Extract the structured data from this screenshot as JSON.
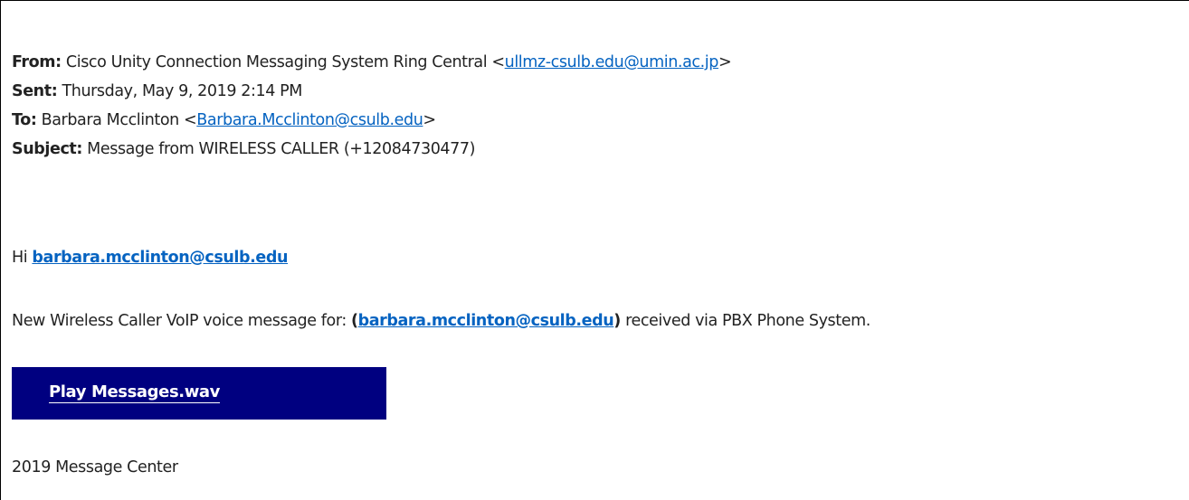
{
  "colors": {
    "link": "#0563c1",
    "button_bg": "#000080",
    "button_text": "#ffffff",
    "text": "#222222"
  },
  "header": {
    "from_label": "From:",
    "from_name": "Cisco Unity Connection Messaging System Ring Central <",
    "from_email": "ullmz-csulb.edu@umin.ac.jp",
    "from_close": ">",
    "sent_label": "Sent:",
    "sent_value": "Thursday, May 9, 2019 2:14 PM",
    "to_label": "To:",
    "to_name": "Barbara Mcclinton <",
    "to_email": "Barbara.Mcclinton@csulb.edu",
    "to_close": ">",
    "subject_label": "Subject:",
    "subject_value": "Message from WIRELESS CALLER (+12084730477)"
  },
  "body": {
    "greeting_prefix": "Hi",
    "greeting_email": "barbara.mcclinton@csulb.edu",
    "notice_prefix": "New Wireless Caller VoIP voice message for:",
    "notice_open": "(",
    "notice_email": "barbara.mcclinton@csulb.edu",
    "notice_close": ")",
    "notice_suffix": "received via PBX Phone System.",
    "button_label": "Play Messages.wav",
    "footer": "2019 Message Center"
  }
}
